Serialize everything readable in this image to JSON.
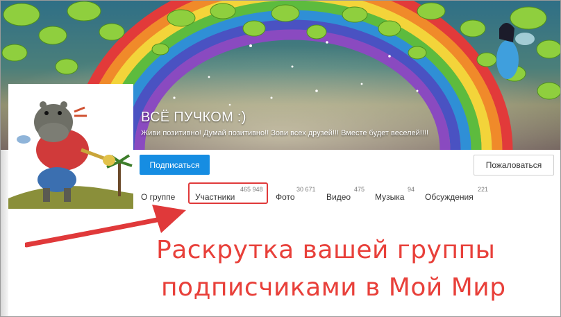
{
  "group": {
    "title": "ВСЁ ПУЧКОМ :)",
    "description": "Живи позитивно! Думай позитивно!! Зови всех друзей!!! Вместе будет веселей!!!!"
  },
  "actions": {
    "subscribe_label": "Подписаться",
    "report_label": "Пожаловаться"
  },
  "tabs": [
    {
      "label": "О группе",
      "count": ""
    },
    {
      "label": "Участники",
      "count": "465 948"
    },
    {
      "label": "Фото",
      "count": "30 671"
    },
    {
      "label": "Видео",
      "count": "475"
    },
    {
      "label": "Музыка",
      "count": "94"
    },
    {
      "label": "Обсуждения",
      "count": "221"
    }
  ],
  "annotation": {
    "line1": "Раскрутка вашей группы",
    "line2": "подписчиками в Мой Мир",
    "color": "#e8403a"
  },
  "colors": {
    "accent": "#168de2",
    "highlight": "#e0393a"
  }
}
